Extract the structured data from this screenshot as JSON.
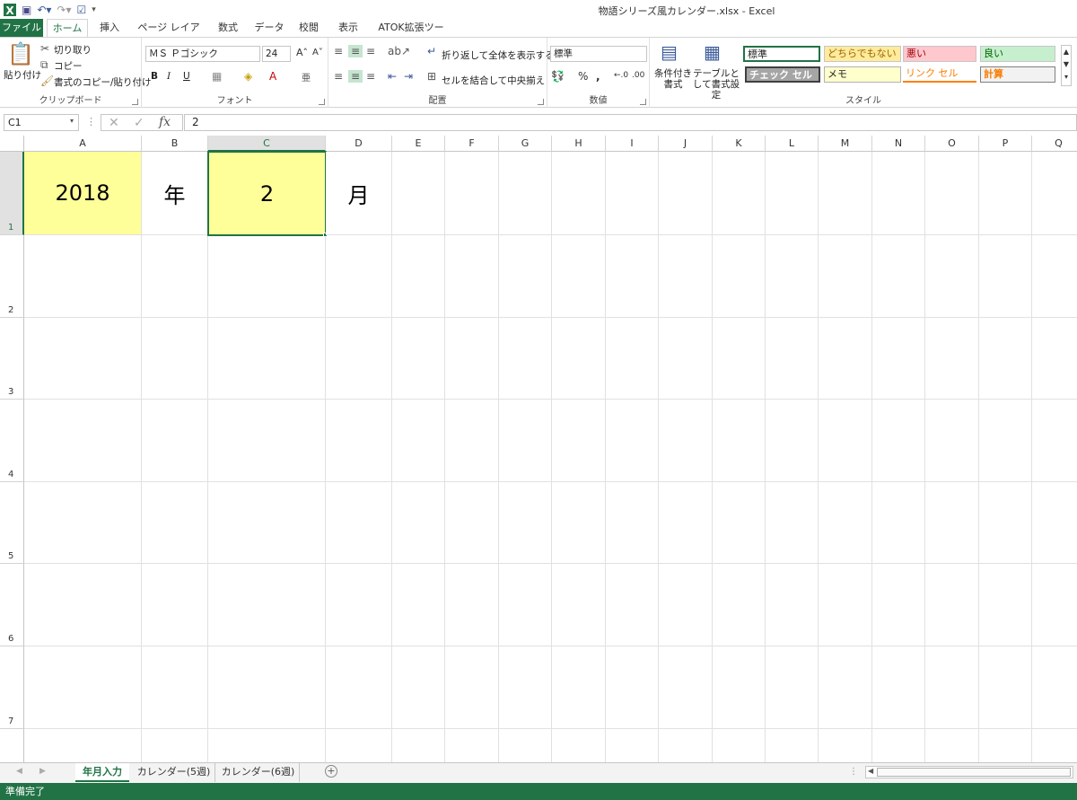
{
  "window": {
    "title": "物語シリーズ風カレンダー.xlsx - Excel"
  },
  "tabs": {
    "file": "ファイル",
    "home": "ホーム",
    "insert": "挿入",
    "layout": "ページ レイアウト",
    "formulas": "数式",
    "data": "データ",
    "review": "校閲",
    "view": "表示",
    "atok": "ATOK拡張ツール"
  },
  "clipboard": {
    "paste": "貼り付け",
    "cut": "切り取り",
    "copy": "コピー",
    "format_painter": "書式のコピー/貼り付け",
    "label": "クリップボード"
  },
  "font": {
    "name": "ＭＳ Ｐゴシック",
    "size": "24",
    "bold": "B",
    "italic": "I",
    "underline": "U",
    "label": "フォント"
  },
  "alignment": {
    "wrap": "折り返して全体を表示する",
    "merge": "セルを結合して中央揃え",
    "label": "配置"
  },
  "number": {
    "format": "標準",
    "label": "数値"
  },
  "styles": {
    "conditional": "条件付き書式",
    "table": "テーブルとして書式設定",
    "label": "スタイル",
    "cells": [
      "標準",
      "どちらでもない",
      "悪い",
      "良い",
      "チェック セル",
      "メモ",
      "リンク セル",
      "計算"
    ]
  },
  "formula_bar": {
    "name_box": "C1",
    "fx": "fx",
    "value": "2"
  },
  "columns": [
    "A",
    "B",
    "C",
    "D",
    "E",
    "F",
    "G",
    "H",
    "I",
    "J",
    "K",
    "L",
    "M",
    "N",
    "O",
    "P",
    "Q"
  ],
  "rows": [
    "1",
    "2",
    "3",
    "4",
    "5",
    "6",
    "7"
  ],
  "cells": {
    "A1": "2018",
    "B1": "年",
    "C1": "2",
    "D1": "月"
  },
  "sheets": [
    "年月入力",
    "カレンダー(5週)",
    "カレンダー(6週)"
  ],
  "status": "準備完了",
  "colors": {
    "accent": "#217346",
    "input_fill": "#ffff99"
  }
}
